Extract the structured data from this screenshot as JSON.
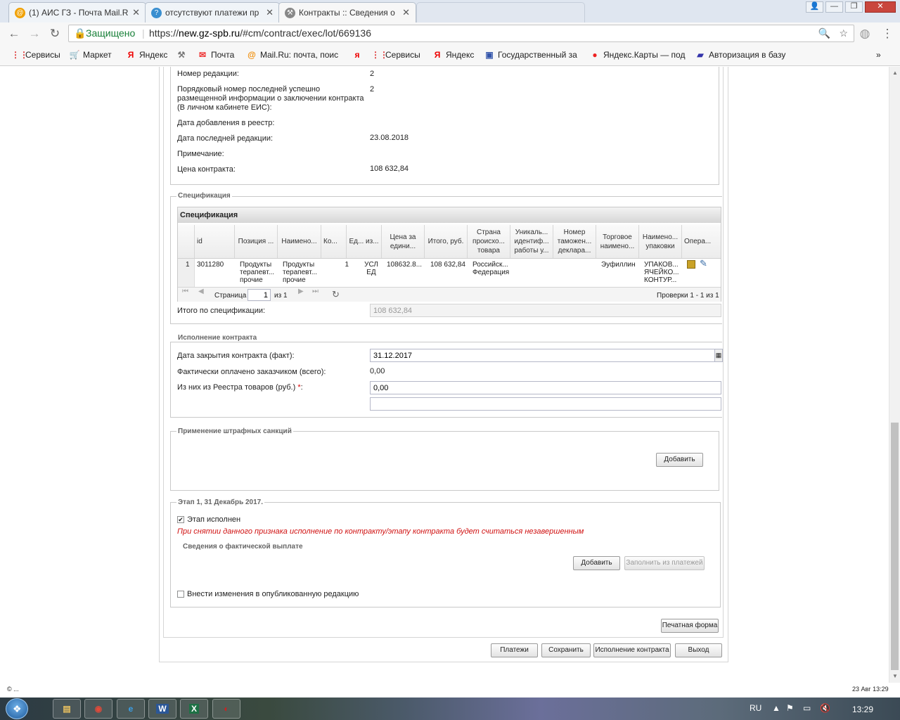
{
  "browser": {
    "tabs": [
      {
        "title": "(1) АИС ГЗ - Почта Mail.R",
        "icon": "mail-at-icon",
        "color": "#f0a000"
      },
      {
        "title": "отсутствуют платежи пр",
        "icon": "question-icon",
        "color": "#3a8fd0"
      },
      {
        "title": "Контракты :: Сведения о",
        "icon": "hammer-icon",
        "color": "#777777"
      }
    ],
    "window_buttons": [
      "👤",
      "—",
      "❐",
      "✕"
    ],
    "security_label": "Защищено",
    "url_prefix": "https://",
    "url_domain": "new.gz-spb.ru",
    "url_path": "/#cm/contract/exec/lot/669136",
    "bookmarks": [
      {
        "label": "Сервисы",
        "icon": "apps-icon",
        "glyph": "⋮⋮"
      },
      {
        "label": "Маркет",
        "icon": "cart-icon",
        "glyph": "🛒"
      },
      {
        "label": "Яндекс",
        "icon": "yandex-icon",
        "glyph": "Я"
      },
      {
        "label": "",
        "icon": "tools-icon",
        "glyph": "⚒"
      },
      {
        "label": "Почта",
        "icon": "mail-icon",
        "glyph": "✉"
      },
      {
        "label": "Mail.Ru: почта, поис",
        "icon": "mailru-icon",
        "glyph": "@"
      },
      {
        "label": "",
        "icon": "yandex-square-icon",
        "glyph": "я"
      },
      {
        "label": "Сервисы",
        "icon": "apps-icon",
        "glyph": "⋮⋮"
      },
      {
        "label": "Яндекс",
        "icon": "yandex-icon",
        "glyph": "Я"
      },
      {
        "label": "Государственный за",
        "icon": "gov-icon",
        "glyph": "▣"
      },
      {
        "label": "Яндекс.Карты — под",
        "icon": "map-pin-icon",
        "glyph": "●"
      },
      {
        "label": "Авторизация в базу",
        "icon": "flag-icon",
        "glyph": "▰"
      }
    ],
    "more": "»"
  },
  "contract_info": {
    "rows": [
      {
        "label": "Номер редакции:",
        "value": "2"
      },
      {
        "label": "Порядковый номер последней успешно размещенной информации о заключении контракта (В личном кабинете ЕИС):",
        "value": "2"
      },
      {
        "label": "Дата добавления в реестр:",
        "value": ""
      },
      {
        "label": "Дата последней редакции:",
        "value": "23.08.2018"
      },
      {
        "label": "Примечание:",
        "value": ""
      },
      {
        "label": "Цена контракта:",
        "value": "108 632,84"
      }
    ]
  },
  "specification": {
    "legend": "Спецификация",
    "grid_title": "Спецификация",
    "columns": [
      "id",
      "Позиция ...",
      "Наимено...",
      "Ко...",
      "Ед... из...",
      "Цена за едини...",
      "Итого, руб.",
      "Страна происхо... товара",
      "Уникаль... идентиф... работы у...",
      "Номер таможен... деклара...",
      "Торговое наимено...",
      "Наимено... упаковки",
      "Опера..."
    ],
    "rows": [
      {
        "num": "1",
        "id": "3011280",
        "position": "Продукты терапевт... прочие",
        "name": "Продукты терапевт... прочие",
        "qty": "1",
        "unit": "УСЛ ЕД",
        "price": "108632.8...",
        "total": "108 632,84",
        "country": "Российск... Федерация",
        "uid": "",
        "customs": "",
        "trade_name": "Эуфиллин",
        "package": "УПАКОВ... ЯЧЕЙКО... КОНТУР..."
      }
    ],
    "pager": {
      "first": "⏮",
      "prev": "◀",
      "page_label": "Страница",
      "page_value": "1",
      "of_label": "из 1",
      "next": "▶",
      "last": "⏭",
      "refresh": "↻",
      "summary": "Проверки 1 - 1 из 1"
    },
    "total_label": "Итого по спецификации:",
    "total_value": "108 632,84"
  },
  "execution": {
    "legend": "Исполнение контракта",
    "close_date_label": "Дата закрытия контракта (факт):",
    "close_date_value": "31.12.2017",
    "paid_label": "Фактически оплачено заказчиком (всего):",
    "paid_value": "0,00",
    "registry_label": "Из них из Реестра товаров (руб.)",
    "required_mark": "*",
    "registry_colon": ":",
    "registry_value": "0,00",
    "extra_value": ""
  },
  "penalties": {
    "legend": "Применение штрафных санкций",
    "add_label": "Добавить"
  },
  "stage": {
    "legend": "Этап 1, 31 Декабрь 2017.",
    "done_label": "Этап исполнен",
    "done_checked": "✔",
    "warning": "При снятии данного признака исполнение по контракту/этапу контракта будет считаться незавершенным",
    "payments_label": "Сведения о фактической выплате",
    "add_label": "Добавить",
    "fill_label": "Заполнить из платежей",
    "edit_published_label": "Внести изменения в опубликованную редакцию"
  },
  "actions": {
    "print": "Печатная форма",
    "payments": "Платежи",
    "save": "Сохранить",
    "execute": "Исполнение контракта",
    "exit": "Выход"
  },
  "statusbar": {
    "left": "© ...",
    "right": "23 Авг 13:29"
  },
  "taskbar": {
    "apps": [
      {
        "name": "taskbar-folder-icon",
        "glyph": "▤",
        "color": "#e8c060"
      },
      {
        "name": "taskbar-chrome-icon",
        "glyph": "◉",
        "color": "#e04a3a"
      },
      {
        "name": "taskbar-ie-icon",
        "glyph": "e",
        "color": "#3aa0e8"
      },
      {
        "name": "taskbar-word-icon",
        "glyph": "W",
        "color": "#2b5797"
      },
      {
        "name": "taskbar-excel-icon",
        "glyph": "X",
        "color": "#1e7145"
      },
      {
        "name": "taskbar-app-icon",
        "glyph": "◐",
        "color": "#d02020"
      }
    ],
    "lang": "RU",
    "clock": "13:29"
  }
}
